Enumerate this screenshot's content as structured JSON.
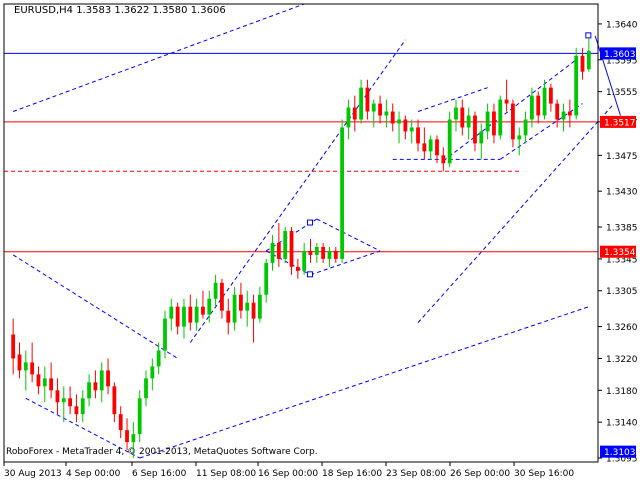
{
  "window": {
    "symbol_title": "EURUSD,H4  1.3583 1.3622 1.3580 1.3606",
    "copyright": "RoboForex - MetaTrader 4, © 2001-2013, MetaQuotes Software Corp."
  },
  "colors": {
    "background": "#ffffff",
    "bull": "#00c800",
    "bear": "#ff0000",
    "hline_blue": "#0000ff",
    "hline_red": "#ff0000",
    "trend": "#0000ff",
    "price_tag_bg": "#0000ff",
    "price_tag_red_bg": "#ff0000"
  },
  "chart_data": {
    "type": "candlestick",
    "title": "EURUSD,H4  1.3583 1.3622 1.3580 1.3606",
    "xlabel": "",
    "ylabel": "",
    "grid": false,
    "ylim": [
      1.309,
      1.3665
    ],
    "y_ticks": [
      "1.3640",
      "1.3595",
      "1.3555",
      "1.3517",
      "1.3475",
      "1.3430",
      "1.3385",
      "1.3345",
      "1.3305",
      "1.3260",
      "1.3220",
      "1.3180",
      "1.3140",
      "1.3095"
    ],
    "x_ticks": [
      "30 Aug 2013",
      "4 Sep 00:00",
      "6 Sep 16:00",
      "11 Sep 08:00",
      "16 Sep 00:00",
      "18 Sep 16:00",
      "23 Sep 08:00",
      "26 Sep 00:00",
      "30 Sep 16:00"
    ],
    "horizontal_levels": [
      {
        "value": 1.3603,
        "label": "1.3603",
        "color": "blue"
      },
      {
        "value": 1.3517,
        "label": "1.3517",
        "color": "red"
      },
      {
        "value": 1.3354,
        "label": "1.3354",
        "color": "red"
      },
      {
        "value": 1.3103,
        "label": "1.3103",
        "color": "blue"
      }
    ],
    "dashed_levels": [
      1.3455
    ],
    "candles": [
      [
        1.325,
        1.327,
        1.32,
        1.322
      ],
      [
        1.3225,
        1.324,
        1.3195,
        1.3205
      ],
      [
        1.3205,
        1.323,
        1.318,
        1.3215
      ],
      [
        1.3215,
        1.324,
        1.319,
        1.32
      ],
      [
        1.32,
        1.321,
        1.3175,
        1.3185
      ],
      [
        1.3185,
        1.321,
        1.3165,
        1.3195
      ],
      [
        1.3195,
        1.3215,
        1.317,
        1.318
      ],
      [
        1.318,
        1.3195,
        1.315,
        1.3165
      ],
      [
        1.3165,
        1.3185,
        1.314,
        1.317
      ],
      [
        1.317,
        1.3185,
        1.315,
        1.316
      ],
      [
        1.316,
        1.3175,
        1.314,
        1.315
      ],
      [
        1.315,
        1.318,
        1.314,
        1.317
      ],
      [
        1.317,
        1.32,
        1.316,
        1.319
      ],
      [
        1.319,
        1.3205,
        1.317,
        1.318
      ],
      [
        1.318,
        1.3215,
        1.3165,
        1.3205
      ],
      [
        1.3205,
        1.322,
        1.3175,
        1.3185
      ],
      [
        1.3185,
        1.319,
        1.314,
        1.315
      ],
      [
        1.315,
        1.316,
        1.312,
        1.313
      ],
      [
        1.313,
        1.3145,
        1.3105,
        1.3115
      ],
      [
        1.3115,
        1.314,
        1.3095,
        1.3125
      ],
      [
        1.3125,
        1.318,
        1.3115,
        1.317
      ],
      [
        1.317,
        1.3205,
        1.316,
        1.3195
      ],
      [
        1.3195,
        1.322,
        1.318,
        1.321
      ],
      [
        1.321,
        1.324,
        1.32,
        1.323
      ],
      [
        1.323,
        1.328,
        1.322,
        1.327
      ],
      [
        1.327,
        1.3295,
        1.3255,
        1.3285
      ],
      [
        1.3285,
        1.329,
        1.325,
        1.326
      ],
      [
        1.326,
        1.3295,
        1.3245,
        1.3285
      ],
      [
        1.3285,
        1.33,
        1.3255,
        1.3265
      ],
      [
        1.3265,
        1.3295,
        1.3255,
        1.3285
      ],
      [
        1.3285,
        1.3305,
        1.327,
        1.3275
      ],
      [
        1.3275,
        1.3305,
        1.3265,
        1.3295
      ],
      [
        1.3295,
        1.3325,
        1.3285,
        1.3315
      ],
      [
        1.3315,
        1.332,
        1.327,
        1.328
      ],
      [
        1.328,
        1.3295,
        1.325,
        1.3265
      ],
      [
        1.3265,
        1.331,
        1.3255,
        1.33
      ],
      [
        1.33,
        1.3315,
        1.327,
        1.328
      ],
      [
        1.328,
        1.3305,
        1.326,
        1.329
      ],
      [
        1.329,
        1.33,
        1.324,
        1.327
      ],
      [
        1.327,
        1.331,
        1.3265,
        1.33
      ],
      [
        1.33,
        1.3345,
        1.329,
        1.334
      ],
      [
        1.334,
        1.3375,
        1.333,
        1.3365
      ],
      [
        1.3365,
        1.339,
        1.3335,
        1.3345
      ],
      [
        1.3345,
        1.3385,
        1.334,
        1.338
      ],
      [
        1.338,
        1.3385,
        1.3325,
        1.3335
      ],
      [
        1.3335,
        1.3345,
        1.332,
        1.333
      ],
      [
        1.333,
        1.3365,
        1.3325,
        1.3355
      ],
      [
        1.3355,
        1.337,
        1.334,
        1.335
      ],
      [
        1.335,
        1.3365,
        1.334,
        1.336
      ],
      [
        1.336,
        1.3365,
        1.334,
        1.3345
      ],
      [
        1.3345,
        1.336,
        1.3335,
        1.3355
      ],
      [
        1.3355,
        1.336,
        1.334,
        1.3345
      ],
      [
        1.3345,
        1.352,
        1.334,
        1.351
      ],
      [
        1.351,
        1.3545,
        1.3495,
        1.3535
      ],
      [
        1.3535,
        1.355,
        1.3505,
        1.352
      ],
      [
        1.352,
        1.357,
        1.3515,
        1.356
      ],
      [
        1.356,
        1.357,
        1.352,
        1.353
      ],
      [
        1.353,
        1.3545,
        1.351,
        1.354
      ],
      [
        1.354,
        1.355,
        1.3515,
        1.3525
      ],
      [
        1.3525,
        1.3545,
        1.351,
        1.353
      ],
      [
        1.353,
        1.354,
        1.3505,
        1.3515
      ],
      [
        1.3515,
        1.353,
        1.349,
        1.352
      ],
      [
        1.352,
        1.3525,
        1.3495,
        1.3505
      ],
      [
        1.3505,
        1.352,
        1.349,
        1.351
      ],
      [
        1.351,
        1.352,
        1.348,
        1.349
      ],
      [
        1.349,
        1.351,
        1.347,
        1.348
      ],
      [
        1.348,
        1.35,
        1.347,
        1.3495
      ],
      [
        1.3495,
        1.35,
        1.3465,
        1.3475
      ],
      [
        1.3475,
        1.3485,
        1.3455,
        1.3465
      ],
      [
        1.3465,
        1.353,
        1.346,
        1.352
      ],
      [
        1.352,
        1.3545,
        1.3505,
        1.3535
      ],
      [
        1.3535,
        1.3545,
        1.35,
        1.351
      ],
      [
        1.351,
        1.3535,
        1.3495,
        1.3525
      ],
      [
        1.3525,
        1.353,
        1.348,
        1.349
      ],
      [
        1.349,
        1.3515,
        1.347,
        1.3505
      ],
      [
        1.3505,
        1.354,
        1.3495,
        1.353
      ],
      [
        1.353,
        1.354,
        1.349,
        1.35
      ],
      [
        1.35,
        1.355,
        1.3495,
        1.3545
      ],
      [
        1.3545,
        1.357,
        1.353,
        1.354
      ],
      [
        1.354,
        1.3545,
        1.3485,
        1.3495
      ],
      [
        1.3495,
        1.351,
        1.3475,
        1.35
      ],
      [
        1.35,
        1.353,
        1.349,
        1.352
      ],
      [
        1.352,
        1.356,
        1.351,
        1.355
      ],
      [
        1.355,
        1.3555,
        1.3515,
        1.3525
      ],
      [
        1.3525,
        1.357,
        1.352,
        1.356
      ],
      [
        1.356,
        1.3565,
        1.353,
        1.354
      ],
      [
        1.354,
        1.3545,
        1.351,
        1.352
      ],
      [
        1.352,
        1.354,
        1.3505,
        1.353
      ],
      [
        1.353,
        1.3545,
        1.351,
        1.3525
      ],
      [
        1.3525,
        1.361,
        1.352,
        1.36
      ],
      [
        1.36,
        1.361,
        1.357,
        1.358
      ],
      [
        1.3583,
        1.3622,
        1.358,
        1.3606
      ]
    ],
    "trend_lines": [
      {
        "from": [
          0,
          1.335
        ],
        "to": [
          26,
          1.322
        ],
        "style": "dashed"
      },
      {
        "from": [
          2,
          1.317
        ],
        "to": [
          20,
          1.3095
        ],
        "style": "dashed"
      },
      {
        "from": [
          0,
          1.353
        ],
        "to": [
          46,
          1.3665
        ],
        "style": "dashed"
      },
      {
        "from": [
          20,
          1.3095
        ],
        "to": [
          91,
          1.3285
        ],
        "style": "dashed"
      },
      {
        "from": [
          28,
          1.324
        ],
        "to": [
          62,
          1.362
        ],
        "style": "dashed"
      },
      {
        "from": [
          40,
          1.3355
        ],
        "to": [
          48,
          1.3395
        ],
        "style": "dashed"
      },
      {
        "from": [
          40,
          1.3355
        ],
        "to": [
          47,
          1.3325
        ],
        "style": "dashed"
      },
      {
        "from": [
          48,
          1.3395
        ],
        "to": [
          58,
          1.3355
        ],
        "style": "dashed"
      },
      {
        "from": [
          47,
          1.3325
        ],
        "to": [
          58,
          1.3355
        ],
        "style": "dashed"
      },
      {
        "from": [
          64,
          1.353
        ],
        "to": [
          75,
          1.356
        ],
        "style": "dashed"
      },
      {
        "from": [
          60,
          1.347
        ],
        "to": [
          77,
          1.347
        ],
        "style": "dashed"
      },
      {
        "from": [
          68,
          1.3468
        ],
        "to": [
          89,
          1.3595
        ],
        "style": "dashed"
      },
      {
        "from": [
          77,
          1.347
        ],
        "to": [
          90,
          1.354
        ],
        "style": "dashed"
      },
      {
        "from": [
          64,
          1.3265
        ],
        "to": [
          95,
          1.354
        ],
        "style": "dashed"
      },
      {
        "from": [
          92,
          1.3625
        ],
        "to": [
          96,
          1.3525
        ],
        "style": "solid"
      }
    ]
  }
}
